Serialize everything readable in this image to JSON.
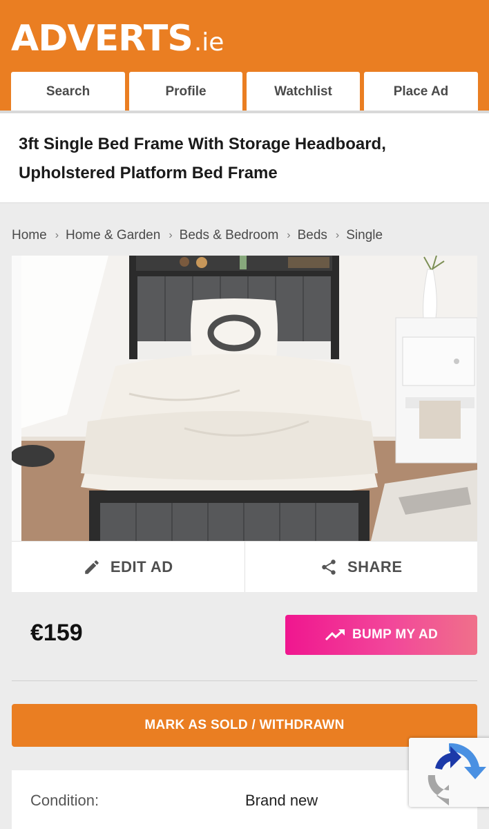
{
  "brand": {
    "logo_main": "ADVERTS",
    "logo_tld": ".ie",
    "accent": "#ea7e22"
  },
  "nav": {
    "tabs": [
      "Search",
      "Profile",
      "Watchlist",
      "Place Ad"
    ]
  },
  "ad": {
    "title": "3ft Single Bed Frame With Storage Headboard, Upholstered Platform Bed Frame",
    "price": "€159",
    "condition_label": "Condition:",
    "condition_value": "Brand new"
  },
  "breadcrumb": [
    "Home",
    "Home & Garden",
    "Beds & Bedroom",
    "Beds",
    "Single"
  ],
  "actions": {
    "edit": "EDIT AD",
    "share": "SHARE",
    "bump": "BUMP MY AD",
    "mark_sold": "MARK AS SOLD / WITHDRAWN"
  },
  "icons": {
    "edit": "pencil-icon",
    "share": "share-icon",
    "bump": "trending-up-icon",
    "recaptcha": "recaptcha-icon"
  },
  "colors": {
    "bump_gradient_start": "#f0168f",
    "bump_gradient_end": "#f0708a"
  }
}
